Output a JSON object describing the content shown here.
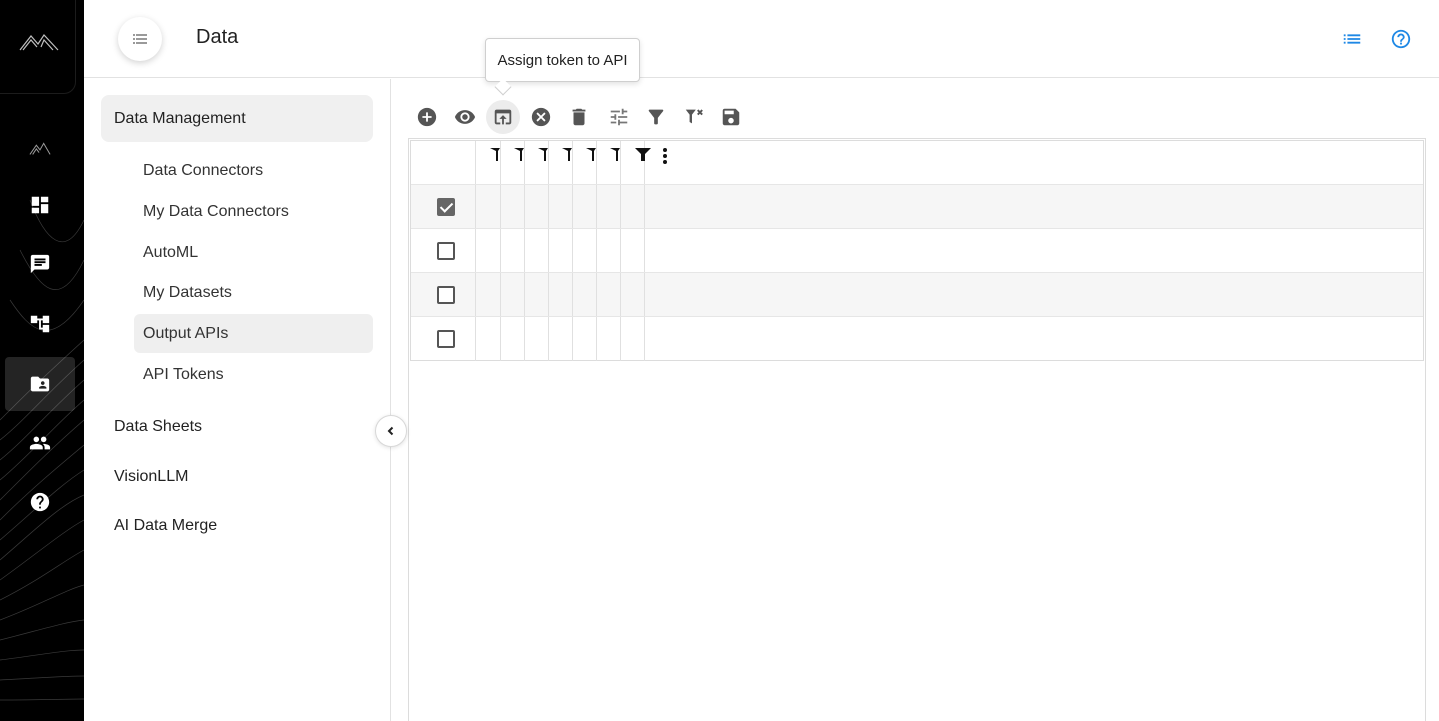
{
  "header": {
    "title": "Data",
    "icons": [
      "menu-icon",
      "list-view-icon",
      "help-icon"
    ]
  },
  "tooltip": {
    "text": "Assign token to API"
  },
  "sidebar": {
    "groups": [
      {
        "label": "Data Management",
        "expanded": true,
        "items": [
          {
            "label": "Data Connectors",
            "active": false
          },
          {
            "label": "My Data Connectors",
            "active": false
          },
          {
            "label": "AutoML",
            "active": false
          },
          {
            "label": "My Datasets",
            "active": false
          },
          {
            "label": "Output APIs",
            "active": true
          },
          {
            "label": "API Tokens",
            "active": false
          }
        ]
      },
      {
        "label": "Data Sheets"
      },
      {
        "label": "VisionLLM"
      },
      {
        "label": "AI Data Merge"
      }
    ]
  },
  "rail": {
    "icons": [
      "mountain-logo-icon",
      "mountain-icon",
      "dashboard-icon",
      "chat-icon",
      "workflow-icon",
      "data-folder-icon",
      "users-icon",
      "help-circle-icon"
    ],
    "active": "data-folder-icon"
  },
  "toolbar": {
    "buttons": [
      "add-icon",
      "view-icon",
      "assign-token-icon",
      "cancel-icon",
      "delete-icon",
      "columns-icon",
      "filter-icon",
      "clear-filter-icon",
      "save-icon"
    ],
    "hovered": "assign-token-icon"
  },
  "grid": {
    "rows": [
      {
        "checked": true
      },
      {
        "checked": false
      },
      {
        "checked": false
      },
      {
        "checked": false
      }
    ]
  },
  "colors": {
    "rail": "#000000",
    "accent": "#1e88e5",
    "active_bg": "#efefef"
  }
}
